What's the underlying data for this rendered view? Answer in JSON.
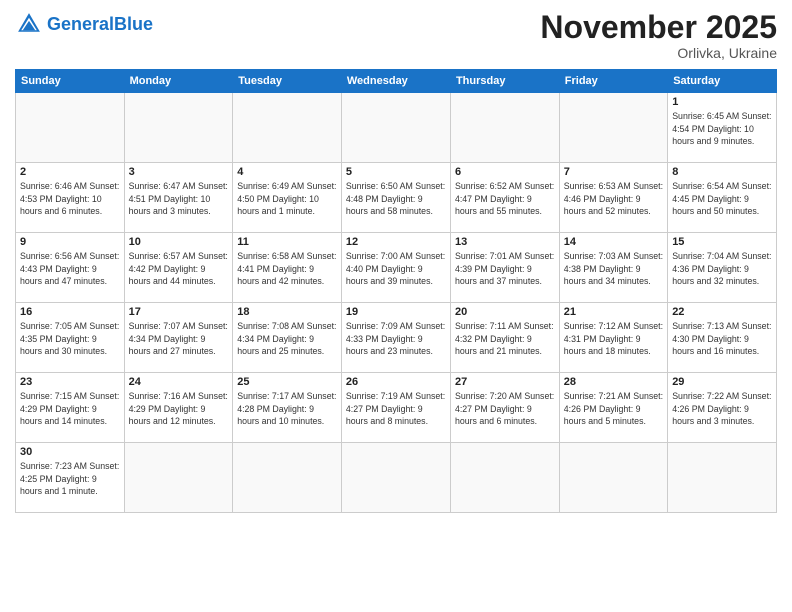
{
  "header": {
    "logo_general": "General",
    "logo_blue": "Blue",
    "month_year": "November 2025",
    "location": "Orlivka, Ukraine"
  },
  "weekdays": [
    "Sunday",
    "Monday",
    "Tuesday",
    "Wednesday",
    "Thursday",
    "Friday",
    "Saturday"
  ],
  "weeks": [
    [
      {
        "day": "",
        "info": ""
      },
      {
        "day": "",
        "info": ""
      },
      {
        "day": "",
        "info": ""
      },
      {
        "day": "",
        "info": ""
      },
      {
        "day": "",
        "info": ""
      },
      {
        "day": "",
        "info": ""
      },
      {
        "day": "1",
        "info": "Sunrise: 6:45 AM\nSunset: 4:54 PM\nDaylight: 10 hours and 9 minutes."
      }
    ],
    [
      {
        "day": "2",
        "info": "Sunrise: 6:46 AM\nSunset: 4:53 PM\nDaylight: 10 hours and 6 minutes."
      },
      {
        "day": "3",
        "info": "Sunrise: 6:47 AM\nSunset: 4:51 PM\nDaylight: 10 hours and 3 minutes."
      },
      {
        "day": "4",
        "info": "Sunrise: 6:49 AM\nSunset: 4:50 PM\nDaylight: 10 hours and 1 minute."
      },
      {
        "day": "5",
        "info": "Sunrise: 6:50 AM\nSunset: 4:48 PM\nDaylight: 9 hours and 58 minutes."
      },
      {
        "day": "6",
        "info": "Sunrise: 6:52 AM\nSunset: 4:47 PM\nDaylight: 9 hours and 55 minutes."
      },
      {
        "day": "7",
        "info": "Sunrise: 6:53 AM\nSunset: 4:46 PM\nDaylight: 9 hours and 52 minutes."
      },
      {
        "day": "8",
        "info": "Sunrise: 6:54 AM\nSunset: 4:45 PM\nDaylight: 9 hours and 50 minutes."
      }
    ],
    [
      {
        "day": "9",
        "info": "Sunrise: 6:56 AM\nSunset: 4:43 PM\nDaylight: 9 hours and 47 minutes."
      },
      {
        "day": "10",
        "info": "Sunrise: 6:57 AM\nSunset: 4:42 PM\nDaylight: 9 hours and 44 minutes."
      },
      {
        "day": "11",
        "info": "Sunrise: 6:58 AM\nSunset: 4:41 PM\nDaylight: 9 hours and 42 minutes."
      },
      {
        "day": "12",
        "info": "Sunrise: 7:00 AM\nSunset: 4:40 PM\nDaylight: 9 hours and 39 minutes."
      },
      {
        "day": "13",
        "info": "Sunrise: 7:01 AM\nSunset: 4:39 PM\nDaylight: 9 hours and 37 minutes."
      },
      {
        "day": "14",
        "info": "Sunrise: 7:03 AM\nSunset: 4:38 PM\nDaylight: 9 hours and 34 minutes."
      },
      {
        "day": "15",
        "info": "Sunrise: 7:04 AM\nSunset: 4:36 PM\nDaylight: 9 hours and 32 minutes."
      }
    ],
    [
      {
        "day": "16",
        "info": "Sunrise: 7:05 AM\nSunset: 4:35 PM\nDaylight: 9 hours and 30 minutes."
      },
      {
        "day": "17",
        "info": "Sunrise: 7:07 AM\nSunset: 4:34 PM\nDaylight: 9 hours and 27 minutes."
      },
      {
        "day": "18",
        "info": "Sunrise: 7:08 AM\nSunset: 4:34 PM\nDaylight: 9 hours and 25 minutes."
      },
      {
        "day": "19",
        "info": "Sunrise: 7:09 AM\nSunset: 4:33 PM\nDaylight: 9 hours and 23 minutes."
      },
      {
        "day": "20",
        "info": "Sunrise: 7:11 AM\nSunset: 4:32 PM\nDaylight: 9 hours and 21 minutes."
      },
      {
        "day": "21",
        "info": "Sunrise: 7:12 AM\nSunset: 4:31 PM\nDaylight: 9 hours and 18 minutes."
      },
      {
        "day": "22",
        "info": "Sunrise: 7:13 AM\nSunset: 4:30 PM\nDaylight: 9 hours and 16 minutes."
      }
    ],
    [
      {
        "day": "23",
        "info": "Sunrise: 7:15 AM\nSunset: 4:29 PM\nDaylight: 9 hours and 14 minutes."
      },
      {
        "day": "24",
        "info": "Sunrise: 7:16 AM\nSunset: 4:29 PM\nDaylight: 9 hours and 12 minutes."
      },
      {
        "day": "25",
        "info": "Sunrise: 7:17 AM\nSunset: 4:28 PM\nDaylight: 9 hours and 10 minutes."
      },
      {
        "day": "26",
        "info": "Sunrise: 7:19 AM\nSunset: 4:27 PM\nDaylight: 9 hours and 8 minutes."
      },
      {
        "day": "27",
        "info": "Sunrise: 7:20 AM\nSunset: 4:27 PM\nDaylight: 9 hours and 6 minutes."
      },
      {
        "day": "28",
        "info": "Sunrise: 7:21 AM\nSunset: 4:26 PM\nDaylight: 9 hours and 5 minutes."
      },
      {
        "day": "29",
        "info": "Sunrise: 7:22 AM\nSunset: 4:26 PM\nDaylight: 9 hours and 3 minutes."
      }
    ],
    [
      {
        "day": "30",
        "info": "Sunrise: 7:23 AM\nSunset: 4:25 PM\nDaylight: 9 hours and 1 minute."
      },
      {
        "day": "",
        "info": ""
      },
      {
        "day": "",
        "info": ""
      },
      {
        "day": "",
        "info": ""
      },
      {
        "day": "",
        "info": ""
      },
      {
        "day": "",
        "info": ""
      },
      {
        "day": "",
        "info": ""
      }
    ]
  ]
}
